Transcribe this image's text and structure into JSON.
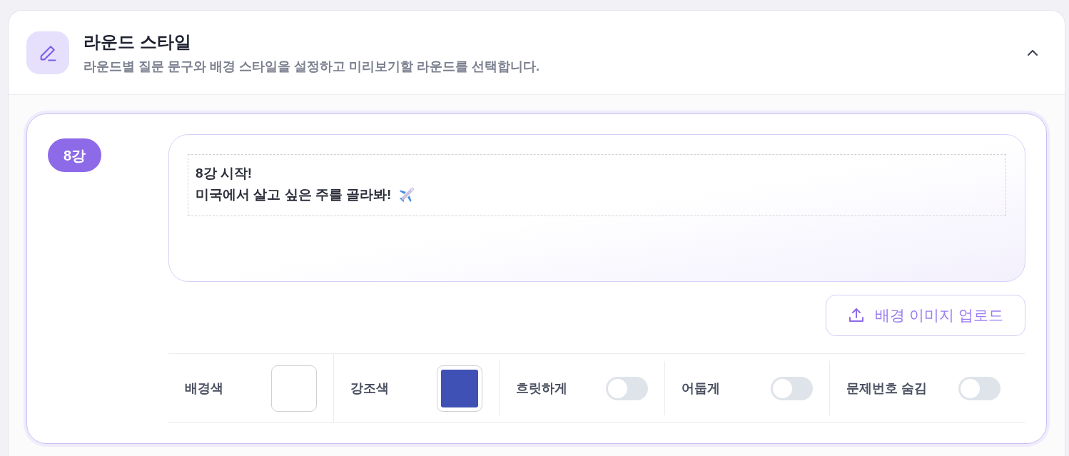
{
  "panel": {
    "title": "라운드 스타일",
    "description": "라운드별 질문 문구와 배경 스타일을 설정하고 미리보기할 라운드를 선택합니다.",
    "expanded": true
  },
  "round": {
    "badge": "8강",
    "question_lines": [
      "8강 시작!",
      "미국에서 살고 싶은 주를 골라봐!"
    ],
    "upload_button": "배경 이미지 업로드",
    "settings": [
      {
        "kind": "color",
        "label": "배경색",
        "color": "#ffffff"
      },
      {
        "kind": "color",
        "label": "강조색",
        "color": "#3f51b5"
      },
      {
        "kind": "toggle",
        "label": "흐릿하게",
        "on": false
      },
      {
        "kind": "toggle",
        "label": "어둡게",
        "on": false
      },
      {
        "kind": "toggle",
        "label": "문제번호 숨김",
        "on": false
      }
    ]
  }
}
